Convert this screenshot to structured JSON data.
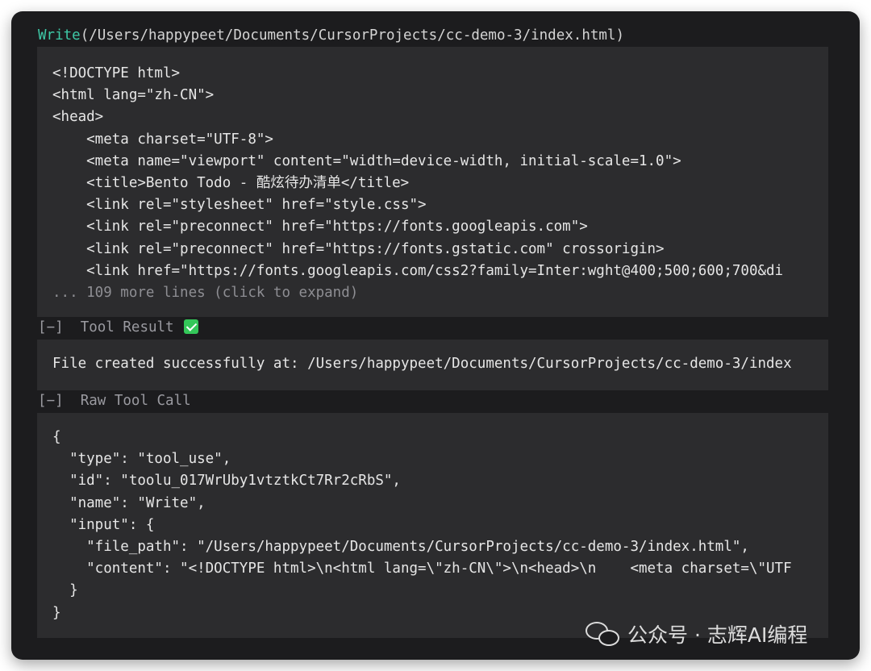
{
  "header": {
    "tool_name": "Write",
    "open_paren": "(",
    "path": "/Users/happypeet/Documents/CursorProjects/cc-demo-3/index.html",
    "close_paren": ")"
  },
  "code_panel": {
    "lines": [
      "<!DOCTYPE html>",
      "<html lang=\"zh-CN\">",
      "<head>",
      "    <meta charset=\"UTF-8\">",
      "    <meta name=\"viewport\" content=\"width=device-width, initial-scale=1.0\">",
      "    <title>Bento Todo - 酷炫待办清单</title>",
      "    <link rel=\"stylesheet\" href=\"style.css\">",
      "    <link rel=\"preconnect\" href=\"https://fonts.googleapis.com\">",
      "    <link rel=\"preconnect\" href=\"https://fonts.gstatic.com\" crossorigin>",
      "    <link href=\"https://fonts.googleapis.com/css2?family=Inter:wght@400;500;600;700&di"
    ],
    "expand_text": "... 109 more lines (click to expand)"
  },
  "tool_result": {
    "toggle": "[−]",
    "label": "Tool Result",
    "message": "File created successfully at: /Users/happypeet/Documents/CursorProjects/cc-demo-3/index"
  },
  "raw_tool_call": {
    "toggle": "[−]",
    "label": "Raw Tool Call",
    "lines": [
      "{",
      "  \"type\": \"tool_use\",",
      "  \"id\": \"toolu_017WrUby1vtztkCt7Rr2cRbS\",",
      "  \"name\": \"Write\",",
      "  \"input\": {",
      "    \"file_path\": \"/Users/happypeet/Documents/CursorProjects/cc-demo-3/index.html\",",
      "    \"content\": \"<!DOCTYPE html>\\n<html lang=\\\"zh-CN\\\">\\n<head>\\n    <meta charset=\\\"UTF",
      "  }",
      "}"
    ]
  },
  "watermark": {
    "text": "公众号 · 志辉AI编程"
  }
}
